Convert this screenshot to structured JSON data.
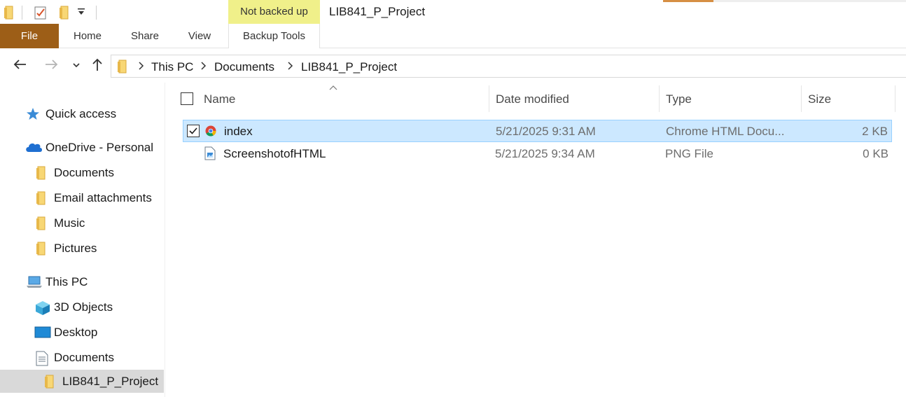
{
  "window": {
    "title": "LIB841_P_Project",
    "contextual_tab_header": "Not backed up"
  },
  "ribbon": {
    "tabs": [
      {
        "label": "File"
      },
      {
        "label": "Home"
      },
      {
        "label": "Share"
      },
      {
        "label": "View"
      },
      {
        "label": "Backup Tools"
      }
    ]
  },
  "address": {
    "breadcrumbs": [
      "This PC",
      "Documents",
      "LIB841_P_Project"
    ]
  },
  "sidebar": {
    "items": [
      {
        "label": "Quick access",
        "icon": "star-icon"
      },
      {
        "label": "OneDrive - Personal",
        "icon": "cloud-icon"
      },
      {
        "label": "Documents",
        "icon": "folder-icon"
      },
      {
        "label": "Email attachments",
        "icon": "folder-icon"
      },
      {
        "label": "Music",
        "icon": "folder-icon"
      },
      {
        "label": "Pictures",
        "icon": "folder-icon"
      },
      {
        "label": "This PC",
        "icon": "computer-icon"
      },
      {
        "label": "3D Objects",
        "icon": "cube-icon"
      },
      {
        "label": "Desktop",
        "icon": "desktop-icon"
      },
      {
        "label": "Documents",
        "icon": "document-icon"
      },
      {
        "label": "LIB841_P_Project",
        "icon": "folder-icon",
        "selected": true
      }
    ]
  },
  "filelist": {
    "columns": [
      "Name",
      "Date modified",
      "Type",
      "Size"
    ],
    "sorted_column": "Name",
    "rows": [
      {
        "name": "index",
        "date": "5/21/2025 9:31 AM",
        "type": "Chrome HTML Docu...",
        "size": "2 KB",
        "icon": "chrome-icon",
        "selected": true,
        "checked": true
      },
      {
        "name": "ScreenshotofHTML",
        "date": "5/21/2025 9:34 AM",
        "type": "PNG File",
        "size": "0 KB",
        "icon": "image-file-icon",
        "selected": false,
        "checked": false
      }
    ]
  },
  "colors": {
    "file_tab": "#9d5e17",
    "contextual_header": "#f0f08a",
    "selection": "#cce8ff",
    "selection_border": "#99d1ff",
    "folder": "#f8d775",
    "nav_selected": "#d9d9d9"
  }
}
